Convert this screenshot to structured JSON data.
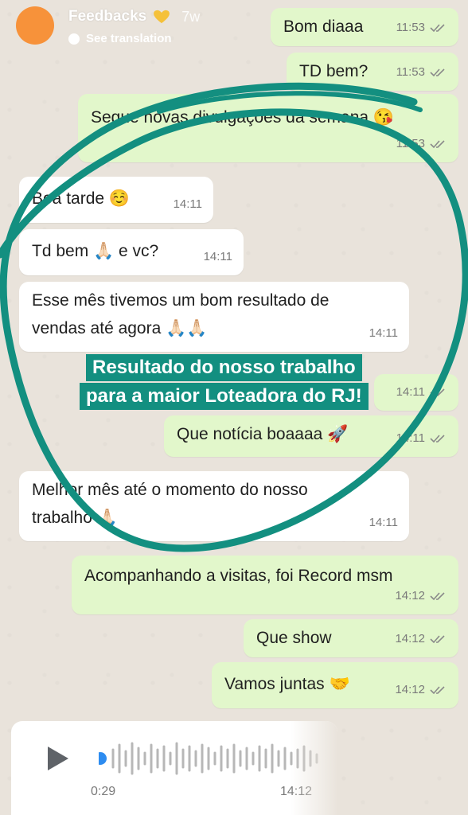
{
  "story": {
    "title": "Feedbacks",
    "age": "7w",
    "see_translation": "See translation",
    "avatar_color": "#f7923a"
  },
  "messages": [
    {
      "text": "Bom diaaa",
      "time": "11:53"
    },
    {
      "text": "TD bem?",
      "time": "11:53"
    },
    {
      "text": "Segue novas divulgaçoes da semana 😘",
      "time": "11:53"
    },
    {
      "text": "Boa tarde ☺️",
      "time": "14:11"
    },
    {
      "text": "Td bem 🙏🏻 e vc?",
      "time": "14:11"
    },
    {
      "text_line1": "Esse mês tivemos um bom resultado de",
      "text_line2": "vendas até agora 🙏🏻🙏🏻",
      "time": "14:11"
    },
    {
      "text": "",
      "time": "14:11"
    },
    {
      "text": "Que notícia boaaaa 🚀",
      "time": "14:11"
    },
    {
      "text_line1": "Melhor mês até o momento do nosso",
      "text_line2": "trabalho 🙏🏻",
      "time": "14:11"
    },
    {
      "text": "Acompanhando a visitas, foi Record msm",
      "time": "14:12"
    },
    {
      "text": "Que show",
      "time": "14:12"
    },
    {
      "text": "Vamos juntas 🤝",
      "time": "14:12"
    }
  ],
  "highlight": {
    "line1": "Resultado do nosso trabalho",
    "line2": "para a maior Loteadora do RJ!",
    "color": "#138f80"
  },
  "audio": {
    "duration": "0:29",
    "time": "14:12"
  },
  "colors": {
    "outgoing_bubble": "#e2f7cb",
    "incoming_bubble": "#ffffff",
    "background": "#e9e3db",
    "scribble": "#138f80"
  }
}
